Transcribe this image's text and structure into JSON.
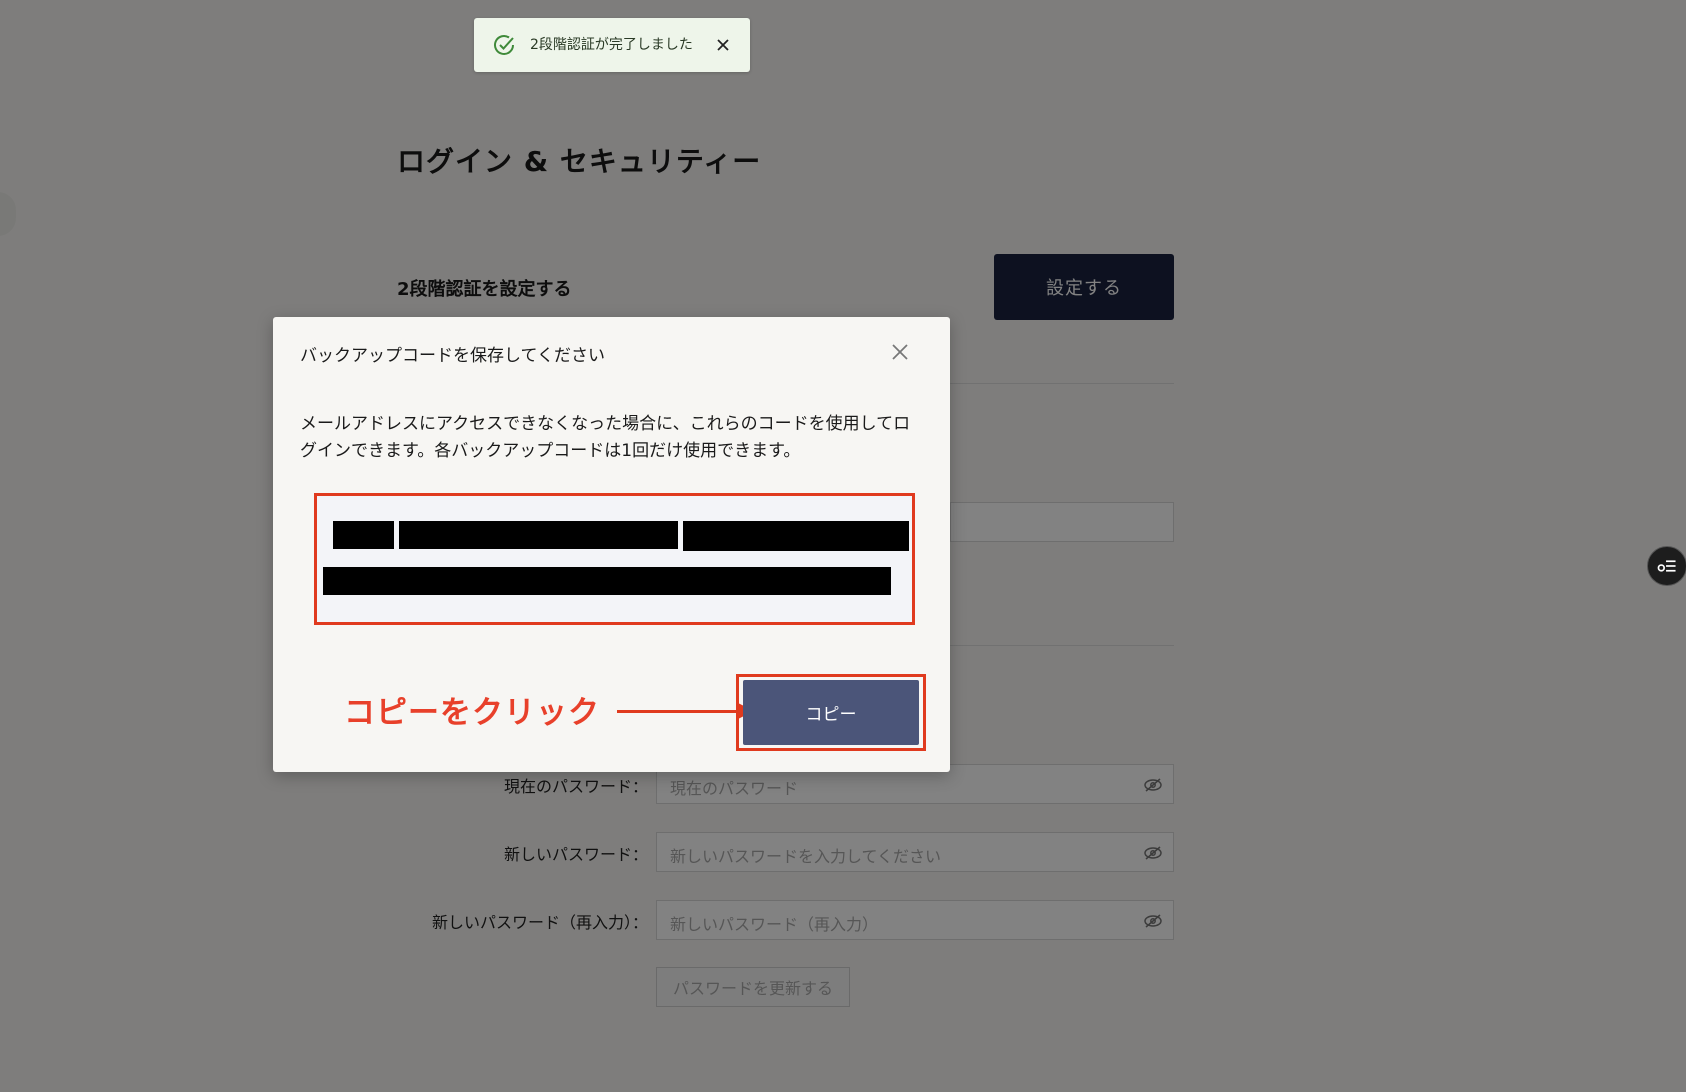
{
  "page": {
    "title": "ログイン & セキュリティー",
    "two_factor": {
      "label": "2段階認証を設定する",
      "button_label": "設定する"
    },
    "password_form": {
      "current": {
        "label": "現在のパスワード：",
        "placeholder": "現在のパスワード"
      },
      "new": {
        "label": "新しいパスワード：",
        "placeholder": "新しいパスワードを入力してください"
      },
      "confirm": {
        "label": "新しいパスワード（再入力）：",
        "placeholder": "新しいパスワード（再入力）"
      },
      "submit_label": "パスワードを更新する"
    }
  },
  "toast": {
    "message": "2段階認証が完了しました"
  },
  "modal": {
    "title": "バックアップコードを保存してください",
    "description": "メールアドレスにアクセスできなくなった場合に、これらのコードを使用してログインできます。各バックアップコードは1回だけ使用できます。",
    "copy_label": "コピー"
  },
  "annotation": {
    "instruction": "コピーをクリック"
  },
  "colors": {
    "primary_button": "#1a2340",
    "copy_button": "#4b5579",
    "annotation_red": "#e03a1e",
    "toast_bg": "#eef5ea",
    "toast_check": "#3f8a3a"
  }
}
